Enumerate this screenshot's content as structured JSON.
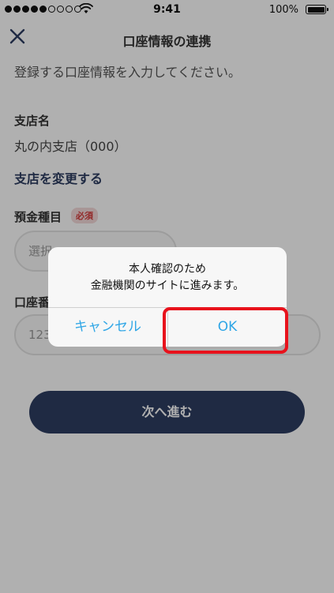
{
  "status_bar": {
    "time": "9:41",
    "battery": "100%",
    "signal": [
      true,
      true,
      true,
      true,
      true,
      false,
      false,
      false,
      false
    ]
  },
  "header": {
    "title": "口座情報の連携",
    "close_icon": "close-icon"
  },
  "form": {
    "instruction": "登録する口座情報を入力してください。",
    "branch": {
      "label": "支店名",
      "value": "丸の内支店（000）",
      "change_link": "支店を変更する"
    },
    "deposit_type": {
      "label": "預金種目",
      "required_badge": "必須",
      "placeholder": "選択"
    },
    "account_number": {
      "label": "口座番号",
      "placeholder": "123"
    },
    "next_button": "次へ進む"
  },
  "dialog": {
    "message_line1": "本人確認のため",
    "message_line2": "金融機関のサイトに進みます。",
    "cancel_label": "キャンセル",
    "ok_label": "OK"
  },
  "colors": {
    "navy": "#2e3d62",
    "dialog_button": "#2fa6e6",
    "highlight": "#e8121c",
    "badge_text": "#d43c3c"
  }
}
